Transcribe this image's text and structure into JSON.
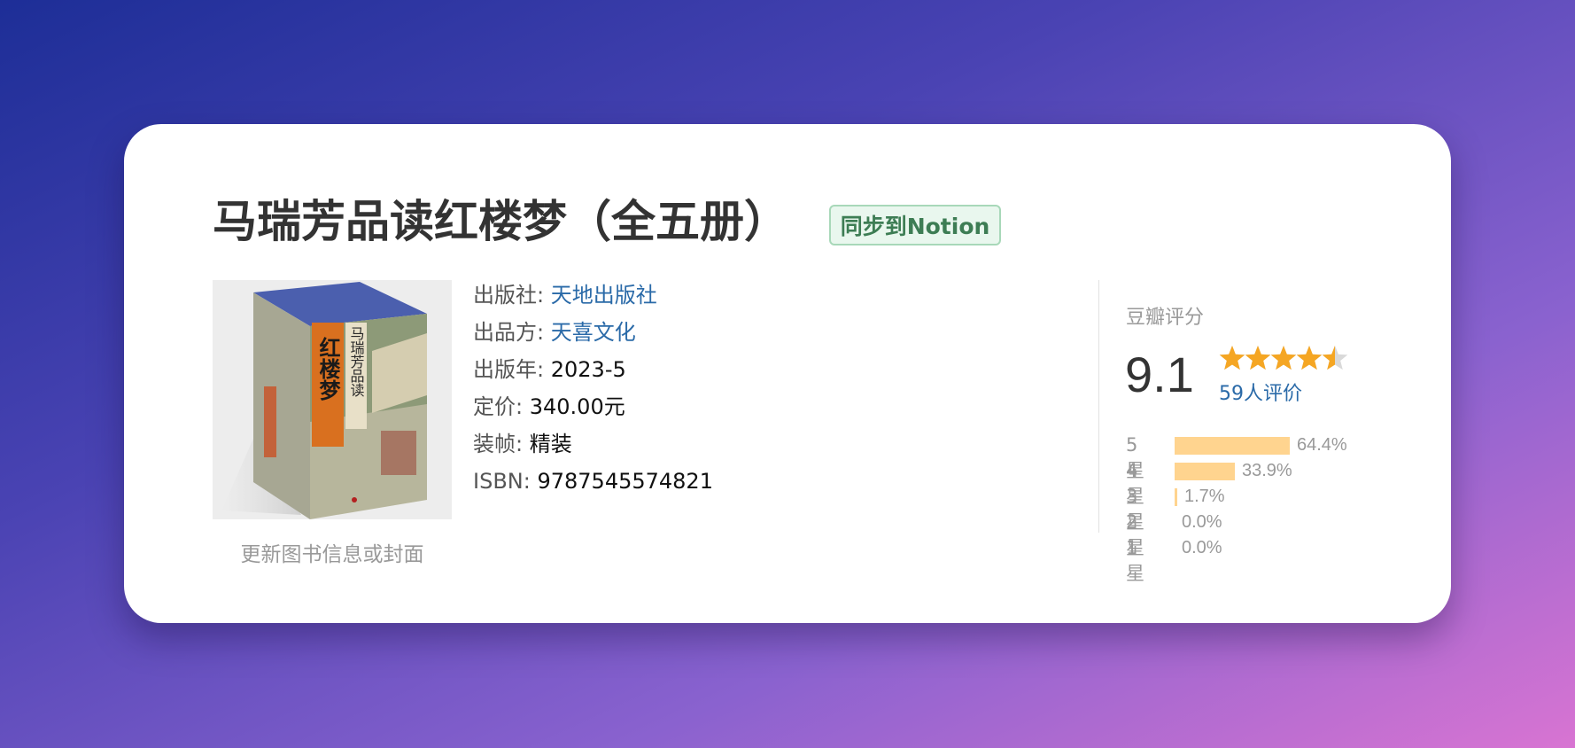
{
  "book": {
    "title": "马瑞芳品读红楼梦（全五册）",
    "sync_button": "同步到Notion",
    "update_link": "更新图书信息或封面",
    "cover_texts": {
      "main_title": "红楼梦",
      "subtitle": "马瑞芳品读"
    }
  },
  "info": {
    "publisher_label": "出版社:",
    "publisher": "天地出版社",
    "producer_label": "出品方:",
    "producer": "天喜文化",
    "year_label": "出版年:",
    "year": "2023-5",
    "price_label": "定价:",
    "price": "340.00元",
    "binding_label": "装帧:",
    "binding": "精装",
    "isbn_label": "ISBN:",
    "isbn": "9787545574821"
  },
  "rating": {
    "label": "豆瓣评分",
    "score": "9.1",
    "stars": 4.5,
    "count_text": "59人评价",
    "distribution": [
      {
        "label": "5星",
        "percent": 64.4,
        "text": "64.4%"
      },
      {
        "label": "4星",
        "percent": 33.9,
        "text": "33.9%"
      },
      {
        "label": "3星",
        "percent": 1.7,
        "text": "1.7%"
      },
      {
        "label": "2星",
        "percent": 0.0,
        "text": "0.0%"
      },
      {
        "label": "1星",
        "percent": 0.0,
        "text": "0.0%"
      }
    ],
    "colors": {
      "star": "#f5a623",
      "star_empty": "#d9d9d9",
      "bar": "#ffd48f"
    }
  }
}
